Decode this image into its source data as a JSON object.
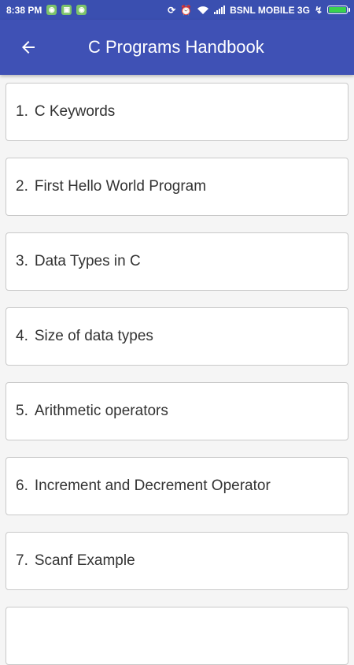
{
  "status_bar": {
    "time": "8:38 PM",
    "carrier": "BSNL MOBILE 3G",
    "notification_icons": [
      "android-icon",
      "shopping-bag-icon",
      "android-icon"
    ],
    "battery_level": 1.0
  },
  "app_bar": {
    "back_icon": "arrow-left-icon",
    "title": "C Programs Handbook"
  },
  "colors": {
    "primary": "#3f51b5",
    "status_bar": "#3a4fb0",
    "card_background": "#ffffff",
    "page_background": "#f5f5f5",
    "text": "#333333"
  },
  "programs": [
    {
      "number": "1.",
      "title": "C Keywords"
    },
    {
      "number": "2.",
      "title": "First Hello World Program"
    },
    {
      "number": "3.",
      "title": "Data Types in C"
    },
    {
      "number": "4.",
      "title": "Size of data types"
    },
    {
      "number": "5.",
      "title": "Arithmetic operators"
    },
    {
      "number": "6.",
      "title": "Increment and Decrement Operator"
    },
    {
      "number": "7.",
      "title": "Scanf Example"
    },
    {
      "number": "",
      "title": ""
    }
  ]
}
